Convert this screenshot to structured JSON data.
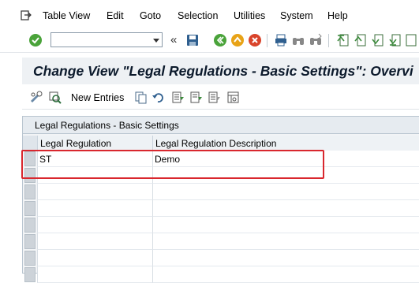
{
  "menu": {
    "items": [
      "Table View",
      "Edit",
      "Goto",
      "Selection",
      "Utilities",
      "System",
      "Help"
    ]
  },
  "system_toolbar": {
    "command_field_value": "",
    "icons": [
      "enter-icon",
      "save-icon",
      "back-icon",
      "exit-icon",
      "cancel-icon",
      "print-icon",
      "find-icon",
      "find-next-icon",
      "first-page-icon",
      "previous-page-icon",
      "next-page-icon",
      "last-page-icon"
    ]
  },
  "title": "Change View \"Legal Regulations - Basic Settings\": Overvi",
  "app_toolbar": {
    "new_entries_label": "New Entries",
    "icons": [
      "display-change-icon",
      "other-entry-icon",
      "copy-as-icon",
      "undo-change-icon",
      "select-all-icon",
      "select-block-icon",
      "deselect-all-icon",
      "configure-icon"
    ]
  },
  "table": {
    "caption": "Legal Regulations - Basic Settings",
    "columns": [
      "Legal Regulation",
      "Legal Regulation Description"
    ],
    "rows": [
      [
        "ST",
        "Demo"
      ],
      [
        "",
        ""
      ],
      [
        "",
        ""
      ],
      [
        "",
        ""
      ],
      [
        "",
        ""
      ],
      [
        "",
        ""
      ],
      [
        "",
        ""
      ],
      [
        "",
        ""
      ]
    ]
  },
  "colors": {
    "highlight": "#d9272e",
    "title_bg": "#eef1f4",
    "title_text": "#0c1a2c"
  }
}
